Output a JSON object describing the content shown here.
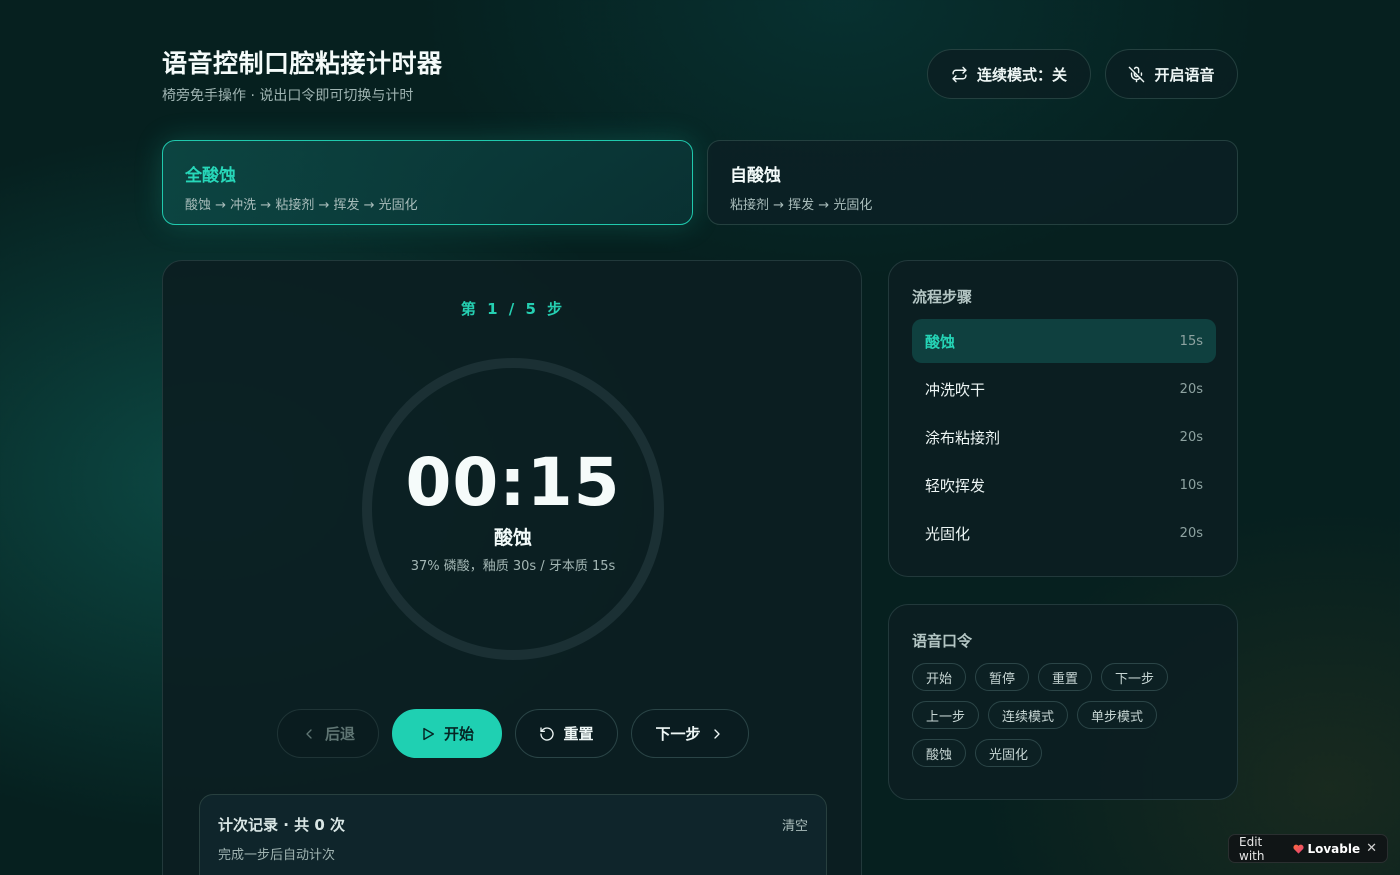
{
  "header": {
    "title": "语音控制口腔粘接计时器",
    "subtitle": "椅旁免手操作 · 说出口令即可切换与计时",
    "continuous_mode_label": "连续模式：关",
    "voice_toggle_label": "开启语音"
  },
  "modes": [
    {
      "name": "全酸蚀",
      "flow": "酸蚀 → 冲洗 → 粘接剂 → 挥发 → 光固化",
      "active": true
    },
    {
      "name": "自酸蚀",
      "flow": "粘接剂 → 挥发 → 光固化",
      "active": false
    }
  ],
  "timer": {
    "step_counter": "第 1 / 5 步",
    "time": "00:15",
    "step_name": "酸蚀",
    "step_desc": "37% 磷酸，釉质 30s / 牙本质 15s",
    "progress": 0
  },
  "controls": {
    "back_label": "后退",
    "start_label": "开始",
    "reset_label": "重置",
    "next_label": "下一步"
  },
  "log": {
    "title": "计次记录 · 共 0 次",
    "hint": "完成一步后自动计次",
    "clear_label": "清空"
  },
  "steps_panel": {
    "title": "流程步骤",
    "steps": [
      {
        "label": "酸蚀",
        "duration": "15s",
        "active": true
      },
      {
        "label": "冲洗吹干",
        "duration": "20s",
        "active": false
      },
      {
        "label": "涂布粘接剂",
        "duration": "20s",
        "active": false
      },
      {
        "label": "轻吹挥发",
        "duration": "10s",
        "active": false
      },
      {
        "label": "光固化",
        "duration": "20s",
        "active": false
      }
    ]
  },
  "voice_panel": {
    "title": "语音口令",
    "commands": [
      "开始",
      "暂停",
      "重置",
      "下一步",
      "上一步",
      "连续模式",
      "单步模式",
      "酸蚀",
      "光固化"
    ]
  },
  "badge": {
    "edit_label": "Edit with",
    "brand": "Lovable",
    "close": "✕"
  },
  "colors": {
    "accent": "#1fd0b2",
    "background": "#06201f",
    "panel": "#0c1e22"
  }
}
